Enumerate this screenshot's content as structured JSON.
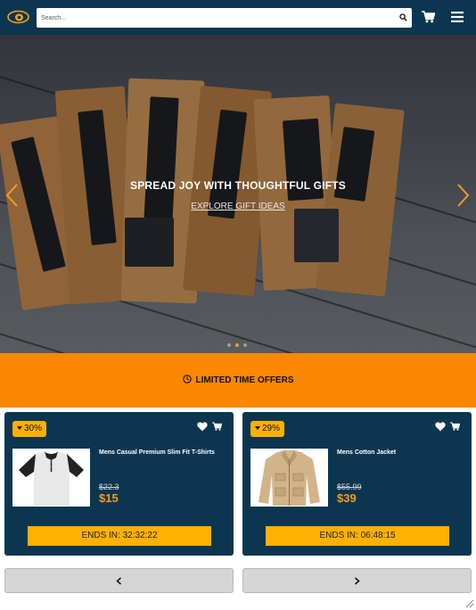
{
  "header": {
    "logo_icon": "eye-logo-icon",
    "search": {
      "placeholder": "Search...",
      "value": ""
    },
    "icons": [
      "search-icon",
      "cart-icon",
      "menu-icon"
    ],
    "brand_color": "#0c3650"
  },
  "hero": {
    "title": "SPREAD JOY WITH THOUGHTFUL GIFTS",
    "link_label": "EXPLORE GIFT IDEAS",
    "slide_count": 3,
    "active_slide": 2
  },
  "offers": {
    "title": "LIMITED TIME OFFERS",
    "accent_color": "#fd8700",
    "products": [
      {
        "discount": "30%",
        "name": "Mens Casual Premium Slim Fit T-Shirts",
        "old_price": "$22.3",
        "new_price": "$15",
        "timer": "ENDS IN: 32:32:22"
      },
      {
        "discount": "29%",
        "name": "Mens Cotton Jacket",
        "old_price": "$55.99",
        "new_price": "$39",
        "timer": "ENDS IN: 06:48:15"
      }
    ],
    "badge_color": "#ffb000",
    "price_color": "#f49b1e"
  },
  "pager": {
    "prev_icon": "chevron-left-icon",
    "next_icon": "chevron-right-icon"
  }
}
